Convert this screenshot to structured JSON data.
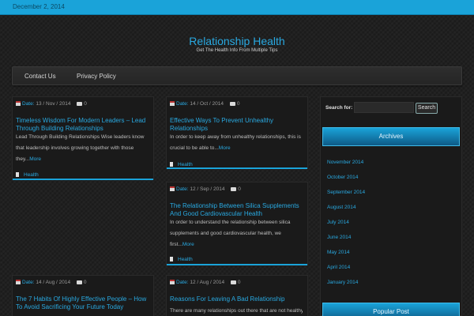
{
  "topbar": {
    "date": "December 2, 2014"
  },
  "site": {
    "title": "Relationship Health",
    "description": "Get The Health Info From Multiple Tips"
  },
  "nav": {
    "items": [
      "Contact Us",
      "Privacy Policy"
    ]
  },
  "labels": {
    "date": "Date:",
    "more": "More"
  },
  "posts": [
    {
      "date": "13 / Nov / 2014",
      "comments": "0",
      "title": "Timeless Wisdom For Modern Leaders – Lead Through Building Relationships",
      "excerpt": "Lead Through Building Relationships Wise leaders know that leadership involves growing together with those they...",
      "category": "Health"
    },
    {
      "date": "14 / Oct / 2014",
      "comments": "0",
      "title": "Effective Ways To Prevent Unhealthy Relationships",
      "excerpt": "In order to keep away from unhealthy relationships, this is crucial to be able to...",
      "category": "Health"
    },
    {
      "date": "12 / Sep / 2014",
      "comments": "0",
      "title": "The Relationship Between Silica Supplements And Good Cardiovascular Health",
      "excerpt": "In order to understand the relationship between silica supplements and good cardiovascular health, we first...",
      "category": "Health"
    },
    {
      "date": "14 / Aug / 2014",
      "comments": "0",
      "title": "The 7 Habits Of Highly Effective People – How To Avoid Sacrificing Your Future Today"
    },
    {
      "date": "12 / Aug / 2014",
      "comments": "0",
      "title": "Reasons For Leaving A Bad Relationship",
      "excerpt": "There are many relationships out there that are not healthy"
    }
  ],
  "sidebar": {
    "search_label": "Search for:",
    "search_value": "",
    "search_button": "Search",
    "archives_title": "Archives",
    "archives": [
      "November 2014",
      "October 2014",
      "September 2014",
      "August 2014",
      "July 2014",
      "June 2014",
      "May 2014",
      "April 2014",
      "January 2014"
    ],
    "popular_title": "Popular Post"
  },
  "colors": {
    "accent": "#29a9e1",
    "topbar": "#1aa3d9",
    "background": "#202020"
  }
}
